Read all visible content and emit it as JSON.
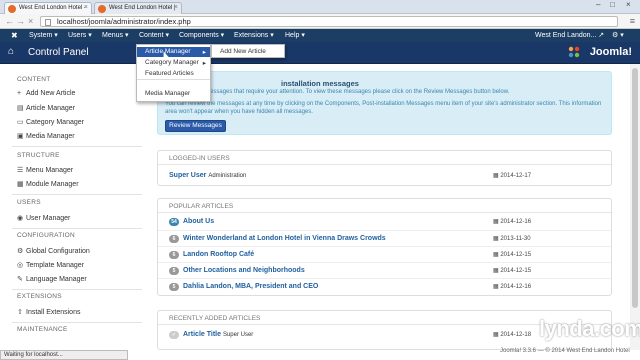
{
  "browser": {
    "tabs": [
      {
        "label": "West End London Hotel - ",
        "active": true
      },
      {
        "label": "West End London Hotel | ",
        "active": false
      }
    ],
    "url": "localhost/joomla/administrator/index.php"
  },
  "topnav": {
    "items": [
      "System",
      "Users",
      "Menus",
      "Content",
      "Components",
      "Extensions",
      "Help"
    ],
    "site_name": "West End Landon..."
  },
  "header": {
    "title": "Control Panel",
    "logo_text": "Joomla!"
  },
  "sidebar": {
    "sections": [
      {
        "heading": "CONTENT",
        "items": [
          "Add New Article",
          "Article Manager",
          "Category Manager",
          "Media Manager"
        ]
      },
      {
        "heading": "STRUCTURE",
        "items": [
          "Menu Manager",
          "Module Manager"
        ]
      },
      {
        "heading": "USERS",
        "items": [
          "User Manager"
        ]
      },
      {
        "heading": "CONFIGURATION",
        "items": [
          "Global Configuration",
          "Template Manager",
          "Language Manager"
        ]
      },
      {
        "heading": "EXTENSIONS",
        "items": [
          "Install Extensions"
        ]
      },
      {
        "heading": "MAINTENANCE",
        "items": []
      }
    ]
  },
  "dropdown": {
    "items": [
      "Article Manager",
      "Category Manager",
      "Featured Articles",
      "Media Manager"
    ],
    "submenu": "Add New Article"
  },
  "alert": {
    "title": "installation messages",
    "line1": "ost-installation messages that require your attention. To view these messages please click on the Review Messages button below.",
    "line2": "You can review the messages at any time by clicking on the Components, Post-installation Messages menu item of your site's administrator section. This information area won't appear when you have hidden all messages.",
    "button": "Review Messages"
  },
  "logged_in": {
    "heading": "LOGGED-IN USERS",
    "rows": [
      {
        "name": "Super User",
        "role": "Administration",
        "date": "2014-12-17"
      }
    ]
  },
  "popular": {
    "heading": "POPULAR ARTICLES",
    "rows": [
      {
        "hits": "54",
        "title": "About Us",
        "date": "2014-12-16"
      },
      {
        "hits": "6",
        "title": "Winter Wonderland at London Hotel in Vienna Draws Crowds",
        "date": "2013-11-30"
      },
      {
        "hits": "6",
        "title": "Landon Rooftop Café",
        "date": "2014-12-15"
      },
      {
        "hits": "5",
        "title": "Other Locations and Neighborhoods",
        "date": "2014-12-15"
      },
      {
        "hits": "5",
        "title": "Dahlia Landon, MBA, President and CEO",
        "date": "2014-12-16"
      }
    ]
  },
  "recent": {
    "heading": "RECENTLY ADDED ARTICLES",
    "rows": [
      {
        "title": "Article Title",
        "author": "Super User",
        "date": "2014-12-18"
      }
    ]
  },
  "status_text": "Waiting for localhost...",
  "footer": "Joomla! 3.3.6 — © 2014 West End Landon Hotel",
  "watermark": "lynda.com"
}
